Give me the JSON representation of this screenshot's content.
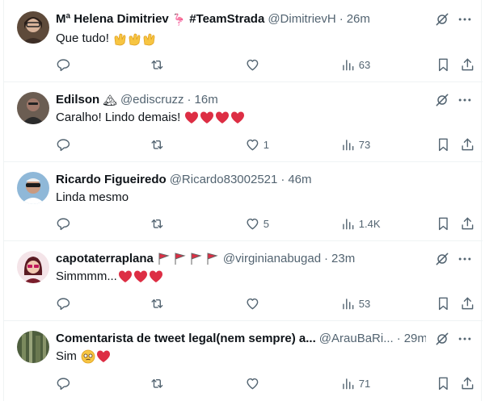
{
  "tweets": [
    {
      "name": "Mª Helena Dimitriev",
      "badge": "🦩",
      "tag": "#TeamStrada",
      "handle": "@DimitrievH",
      "time": "26m",
      "text": "Que tudo!",
      "text_emoji": "👏👏👏",
      "replies": "",
      "retweets": "",
      "likes": "",
      "views": "63"
    },
    {
      "name": "Edilson",
      "badge": "🏔",
      "handle": "@ediscruzz",
      "time": "16m",
      "text": "Caralho! Lindo demais!",
      "text_emoji": "❤❤❤❤",
      "replies": "",
      "retweets": "",
      "likes": "1",
      "views": "73"
    },
    {
      "name": "Ricardo Figueiredo",
      "handle": "@Ricardo83002521",
      "time": "46m",
      "text": "Linda mesmo",
      "text_emoji": "",
      "replies": "",
      "retweets": "",
      "likes": "5",
      "views": "1.4K"
    },
    {
      "name": "capotaterraplana",
      "badge": "🚩🚩🚩🚩",
      "handle": "@virginianabugad",
      "time": "23m",
      "text": "Simmmm...",
      "text_emoji": "❤❤❤",
      "replies": "",
      "retweets": "",
      "likes": "",
      "views": "53"
    },
    {
      "name": "Comentarista de tweet legal(nem sempre) a...",
      "handle": "@ArauBaRi...",
      "time": "29m",
      "text": "Sim",
      "text_emoji": "🥹❤",
      "replies": "",
      "retweets": "",
      "likes": "",
      "views": "71"
    }
  ],
  "colors": {
    "text": "#0f1419",
    "secondary": "#536471",
    "divider": "#eff3f4",
    "heart": "#e0245e",
    "flag": "#dd2e44"
  },
  "icons": [
    "reply-icon",
    "retweet-icon",
    "like-icon",
    "views-icon",
    "bookmark-icon",
    "share-icon",
    "grok-icon",
    "more-icon"
  ]
}
